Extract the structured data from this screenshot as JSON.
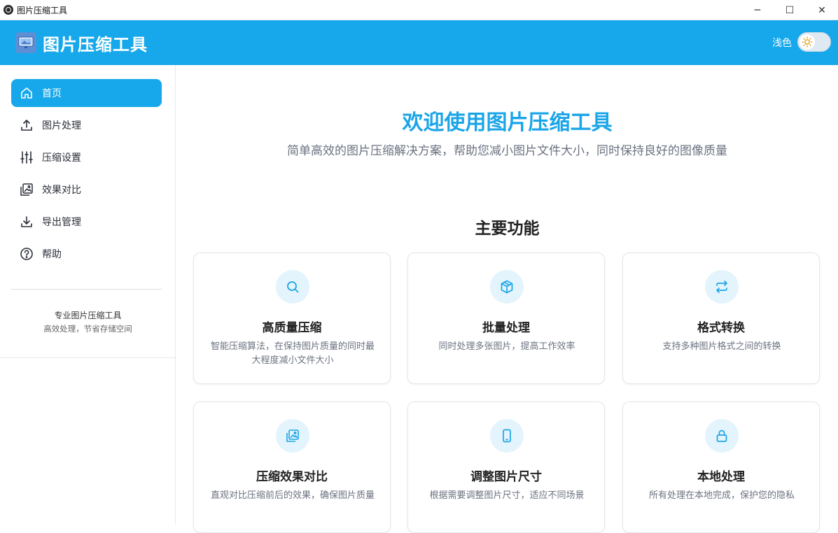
{
  "window": {
    "title": "图片压缩工具",
    "controls": {
      "minimize": "─",
      "maximize": "☐",
      "close": "✕"
    }
  },
  "header": {
    "title": "图片压缩工具",
    "theme_label": "浅色",
    "accent": "#16a8ea"
  },
  "sidebar": {
    "items": [
      {
        "label": "首页",
        "icon": "home-icon",
        "active": true
      },
      {
        "label": "图片处理",
        "icon": "upload-icon",
        "active": false
      },
      {
        "label": "压缩设置",
        "icon": "sliders-icon",
        "active": false
      },
      {
        "label": "效果对比",
        "icon": "images-icon",
        "active": false
      },
      {
        "label": "导出管理",
        "icon": "download-icon",
        "active": false
      },
      {
        "label": "帮助",
        "icon": "help-icon",
        "active": false
      }
    ],
    "footer_title": "专业图片压缩工具",
    "footer_subtitle": "高效处理，节省存储空间"
  },
  "main": {
    "hero_title": "欢迎使用图片压缩工具",
    "hero_subtitle": "简单高效的图片压缩解决方案，帮助您减小图片文件大小，同时保持良好的图像质量",
    "section_title": "主要功能",
    "cards": [
      {
        "title": "高质量压缩",
        "desc": "智能压缩算法，在保持图片质量的同时最大程度减小文件大小",
        "icon": "search-icon"
      },
      {
        "title": "批量处理",
        "desc": "同时处理多张图片，提高工作效率",
        "icon": "cube-icon"
      },
      {
        "title": "格式转换",
        "desc": "支持多种图片格式之间的转换",
        "icon": "swap-icon"
      },
      {
        "title": "压缩效果对比",
        "desc": "直观对比压缩前后的效果，确保图片质量",
        "icon": "images-icon"
      },
      {
        "title": "调整图片尺寸",
        "desc": "根据需要调整图片尺寸，适应不同场景",
        "icon": "phone-icon"
      },
      {
        "title": "本地处理",
        "desc": "所有处理在本地完成，保护您的隐私",
        "icon": "lock-icon"
      }
    ]
  }
}
